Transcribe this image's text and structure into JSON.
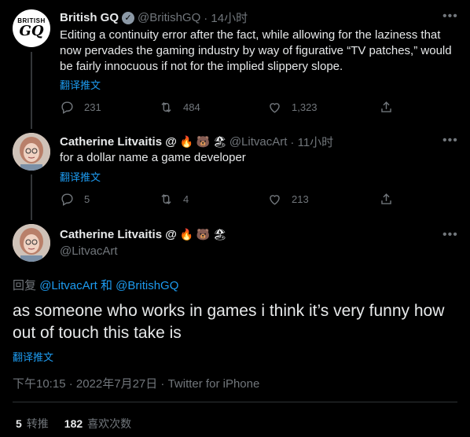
{
  "tweet1": {
    "name": "British GQ",
    "handle": "@BritishGQ",
    "time": "· 14小时",
    "avatar_top": "BRITISH",
    "avatar_bottom": "GQ",
    "text": "Editing a continuity error after the fact, while allowing for the laziness that now pervades the gaming industry by way of figurative “TV patches,” would be fairly innocuous if not for the implied slippery slope.",
    "translate": "翻译推文",
    "replies": "231",
    "retweets": "484",
    "likes": "1,323"
  },
  "tweet2": {
    "name": "Catherine Litvaitis @",
    "emojis": [
      "🔥",
      "🐻",
      "🏖"
    ],
    "handle": "@LitvacArt",
    "time": "· 11小时",
    "text": "for a dollar name a game developer",
    "translate": "翻译推文",
    "replies": "5",
    "retweets": "4",
    "likes": "213"
  },
  "main": {
    "name": "Catherine Litvaitis @",
    "emojis": [
      "🔥",
      "🐻",
      "🏖"
    ],
    "handle": "@LitvacArt",
    "reply_prefix": "回复",
    "reply_to_1": "@LitvacArt",
    "reply_and": "和",
    "reply_to_2": "@BritishGQ",
    "text": "as someone who works in games i think it’s very funny how out of touch this take is",
    "translate": "翻译推文",
    "timestamp": "下午10:15 · 2022年7月27日 · Twitter for iPhone",
    "retweet_count": "5",
    "retweet_label": "转推",
    "like_count": "182",
    "like_label": "喜欢次数"
  },
  "colors": {
    "accent": "#1d9bf0",
    "muted": "#71767b",
    "bg": "#000000"
  }
}
